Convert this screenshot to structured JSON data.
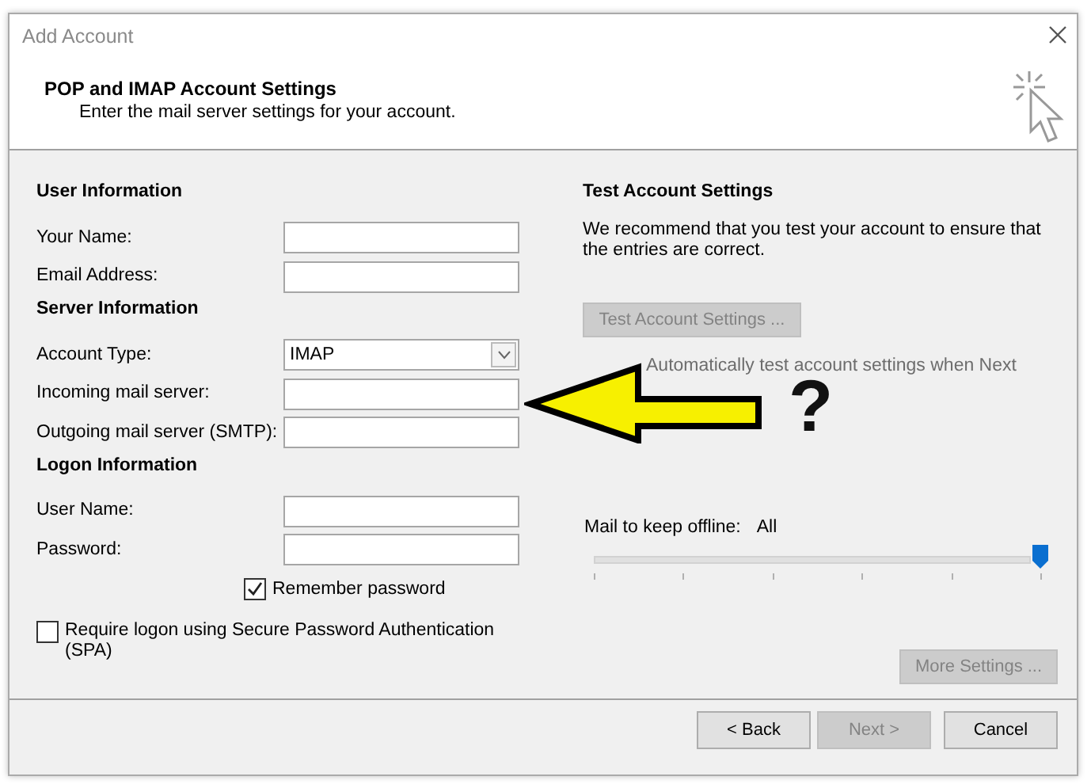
{
  "window": {
    "title": "Add Account"
  },
  "header": {
    "title": "POP and IMAP Account Settings",
    "subtitle": "Enter the mail server settings for your account."
  },
  "groups": [
    {
      "heading": "User Information",
      "rows": [
        {
          "kind": "text",
          "label": "Your Name:"
        },
        {
          "kind": "text",
          "label": "Email Address:"
        }
      ]
    },
    {
      "heading": "Server Information",
      "rows": [
        {
          "kind": "select",
          "label": "Account Type:",
          "value": "IMAP"
        },
        {
          "kind": "text",
          "label": "Incoming mail server:"
        },
        {
          "kind": "text",
          "label": "Outgoing mail server (SMTP):"
        }
      ]
    },
    {
      "heading": "Logon Information",
      "rows": [
        {
          "kind": "text",
          "label": "User Name:"
        },
        {
          "kind": "password",
          "label": "Password:"
        }
      ]
    }
  ],
  "remember_password": {
    "label": "Remember password",
    "checked": true
  },
  "spa": {
    "label": "Require logon using Secure Password Authentication (SPA)",
    "checked": false
  },
  "test": {
    "heading": "Test Account Settings",
    "text": "We recommend that you test your account to ensure that the entries are correct.",
    "button": {
      "label": "Test Account Settings ...",
      "disabled": true
    },
    "auto_test_label": "Automatically test account settings when Next"
  },
  "offline": {
    "label": "Mail to keep offline:",
    "value": "All",
    "level": 1
  },
  "more_settings": {
    "label": "More Settings ...",
    "disabled": true
  },
  "buttons": [
    {
      "label": "< Back",
      "disabled": false
    },
    {
      "label": "Next >",
      "disabled": true
    },
    {
      "label": "Cancel",
      "disabled": false
    }
  ],
  "annotation": {
    "mark": "?"
  }
}
